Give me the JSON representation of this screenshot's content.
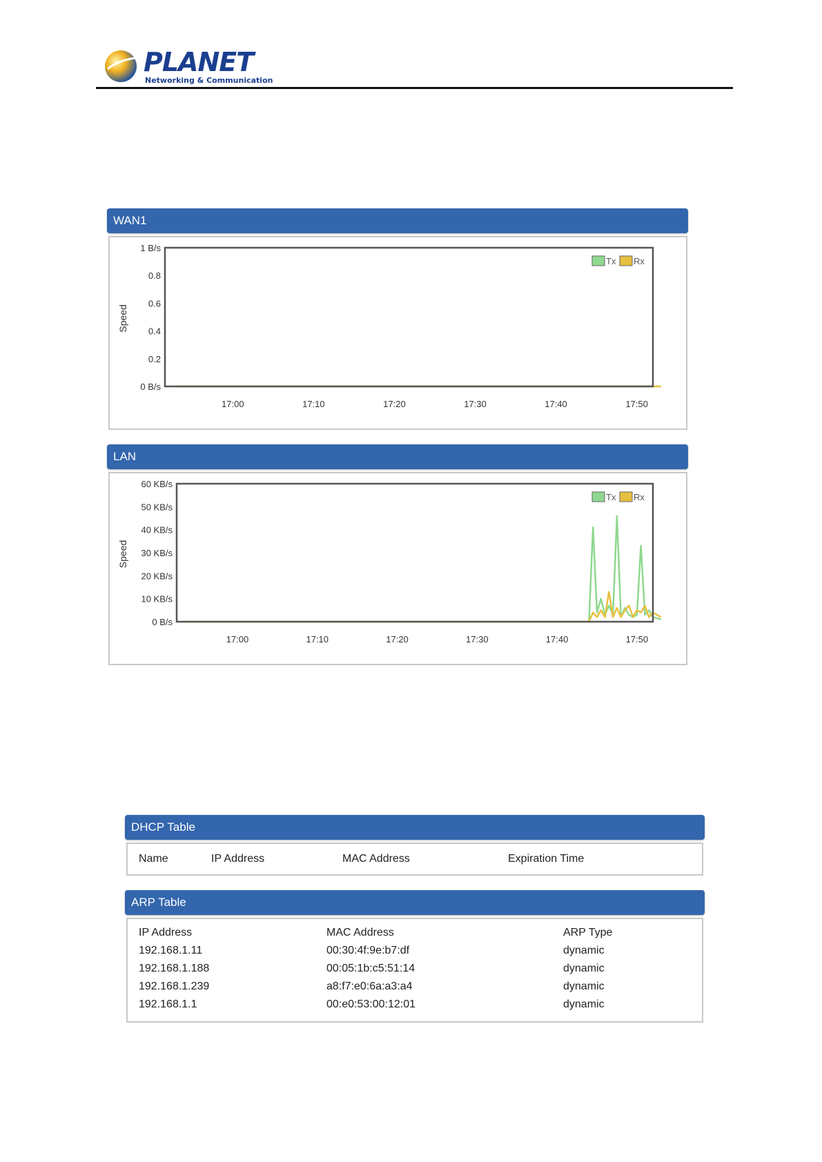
{
  "brand": {
    "name": "PLANET",
    "tagline": "Networking & Communication"
  },
  "colors": {
    "panel_header": "#3366ad",
    "tx": "#8fd88f",
    "rx": "#e8c040"
  },
  "wan_panel": {
    "title": "WAN1",
    "chart_data": {
      "type": "line",
      "ylabel": "Speed",
      "y_ticks": [
        "1 B/s",
        "0.8",
        "0.6",
        "0.4",
        "0.2",
        "0 B/s"
      ],
      "ylim": [
        0,
        1
      ],
      "x_ticks": [
        "17:00",
        "17:10",
        "17:20",
        "17:30",
        "17:40",
        "17:50"
      ],
      "legend": [
        "Tx",
        "Rx"
      ],
      "legend_position": "top-right",
      "grid": false,
      "series": [
        {
          "name": "Tx",
          "x": [
            "16:53",
            "17:53"
          ],
          "values": [
            0,
            0
          ]
        },
        {
          "name": "Rx",
          "x": [
            "16:53",
            "17:53"
          ],
          "values": [
            0,
            0
          ]
        }
      ]
    }
  },
  "lan_panel": {
    "title": "LAN",
    "chart_data": {
      "type": "line",
      "ylabel": "Speed",
      "y_ticks": [
        "60 KB/s",
        "50 KB/s",
        "40 KB/s",
        "30 KB/s",
        "20 KB/s",
        "10 KB/s",
        "0 B/s"
      ],
      "ylim": [
        0,
        60
      ],
      "x_ticks": [
        "17:00",
        "17:10",
        "17:20",
        "17:30",
        "17:40",
        "17:50"
      ],
      "legend": [
        "Tx",
        "Rx"
      ],
      "legend_position": "top-right",
      "grid": false,
      "series": [
        {
          "name": "Tx",
          "x": [
            "16:53",
            "17:44",
            "17:44.5",
            "17:45",
            "17:45.5",
            "17:46",
            "17:46.5",
            "17:47",
            "17:47.5",
            "17:48",
            "17:48.5",
            "17:49",
            "17:49.5",
            "17:50",
            "17:50.5",
            "17:51",
            "17:51.5",
            "17:52",
            "17:53"
          ],
          "values": [
            0,
            0,
            41,
            4,
            10,
            3,
            7,
            3,
            46,
            2,
            6,
            3,
            2,
            3,
            33,
            3,
            5,
            2,
            1
          ]
        },
        {
          "name": "Rx",
          "x": [
            "16:53",
            "17:44",
            "17:44.5",
            "17:45",
            "17:45.5",
            "17:46",
            "17:46.5",
            "17:47",
            "17:47.5",
            "17:48",
            "17:48.5",
            "17:49",
            "17:49.5",
            "17:50",
            "17:50.5",
            "17:51",
            "17:51.5",
            "17:52",
            "17:53"
          ],
          "values": [
            0,
            0,
            4,
            2,
            5,
            2,
            13,
            2,
            6,
            2,
            5,
            7,
            2,
            5,
            4,
            7,
            2,
            4,
            2
          ]
        }
      ]
    }
  },
  "dhcp_table": {
    "title": "DHCP Table",
    "columns": [
      "Name",
      "IP Address",
      "MAC Address",
      "Expiration Time"
    ],
    "rows": []
  },
  "arp_table": {
    "title": "ARP Table",
    "columns": [
      "IP Address",
      "MAC Address",
      "ARP Type"
    ],
    "rows": [
      [
        "192.168.1.11",
        "00:30:4f:9e:b7:df",
        "dynamic"
      ],
      [
        "192.168.1.188",
        "00:05:1b:c5:51:14",
        "dynamic"
      ],
      [
        "192.168.1.239",
        "a8:f7:e0:6a:a3:a4",
        "dynamic"
      ],
      [
        "192.168.1.1",
        "00:e0:53:00:12:01",
        "dynamic"
      ]
    ]
  }
}
